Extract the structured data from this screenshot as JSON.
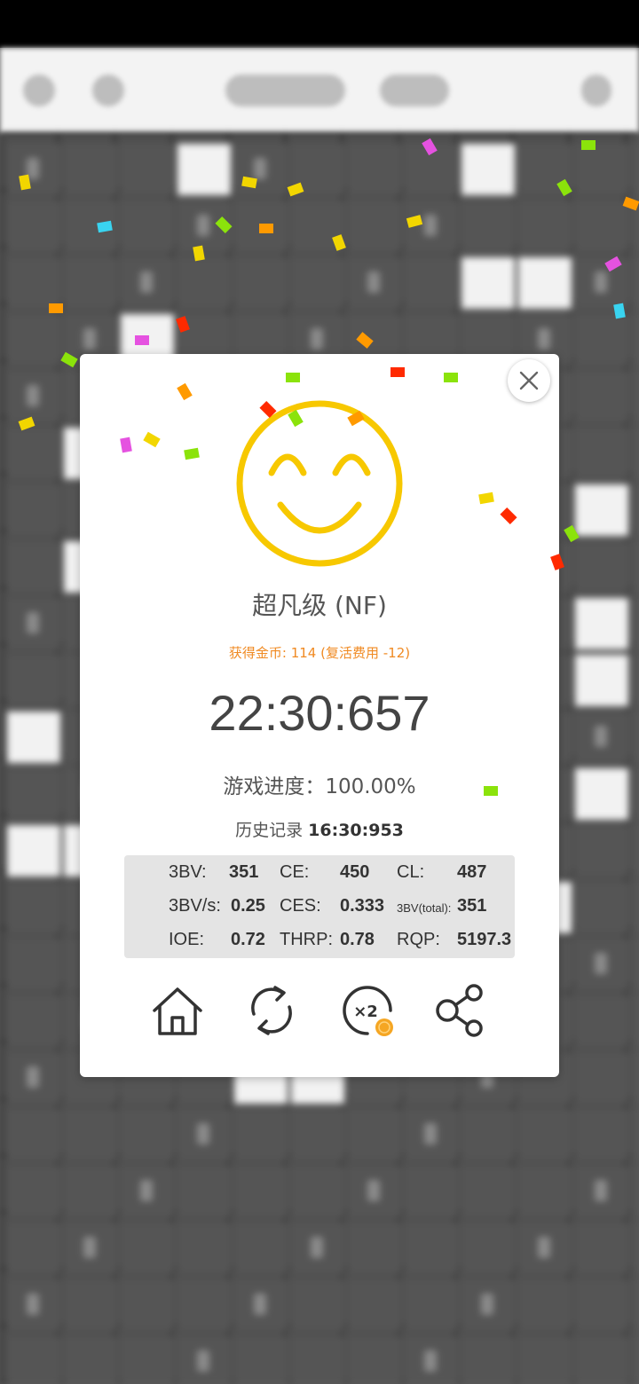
{
  "dialog": {
    "rank": "超凡级 (NF)",
    "coins": "获得金币: 114 (复活费用 -12)",
    "time": "22:30:657",
    "progress": "游戏进度：100.00%",
    "record_label": "历史记录",
    "record_value": "16:30:953"
  },
  "stats": [
    {
      "label": "3BV:",
      "value": "351"
    },
    {
      "label": "CE:",
      "value": "450"
    },
    {
      "label": "CL:",
      "value": "487"
    },
    {
      "label": "3BV/s:",
      "value": "0.25"
    },
    {
      "label": "CES:",
      "value": "0.333"
    },
    {
      "label": "3BV(total):",
      "value": "351"
    },
    {
      "label": "IOE:",
      "value": "0.72"
    },
    {
      "label": "THRP:",
      "value": "0.78"
    },
    {
      "label": "RQP:",
      "value": "5197.3"
    }
  ],
  "actions": {
    "home": "home-icon",
    "restart": "restart-icon",
    "double_reward": "double-reward-icon",
    "double_text": "×2",
    "share": "share-icon"
  },
  "colors": {
    "smiley": "#f7c800",
    "coins": "#f08a22",
    "stats_bg": "#e4e4e4"
  }
}
